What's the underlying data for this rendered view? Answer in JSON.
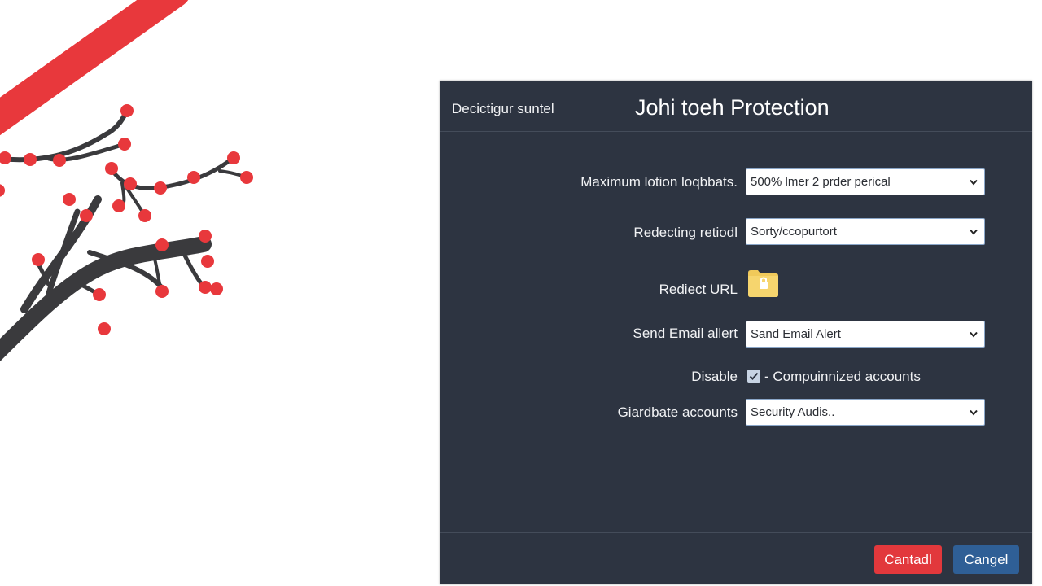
{
  "colors": {
    "dialog_bg": "#2d3441",
    "accent_red": "#e2383c",
    "accent_blue": "#2f5f96",
    "blossom": "#e8383c",
    "branch": "#3a3a3d"
  },
  "dialog": {
    "header_left": "Decictigur suntel",
    "title": "Johi toeh Protection",
    "rows": [
      {
        "label": "Maximum lotion loqbbats.",
        "control": "select",
        "value": "500% lmer 2 prder perical"
      },
      {
        "label": "Redecting retiodl",
        "control": "select",
        "value": "Sorty/ccopurtort"
      },
      {
        "label": "Rediect URL",
        "control": "folder",
        "icon": "folder-lock-icon"
      },
      {
        "label": "Send Email allert",
        "control": "select",
        "value": "Sand Email Alert"
      },
      {
        "label": "Disable",
        "control": "checkbox",
        "checked": true,
        "text": "- Compuinnized accounts"
      },
      {
        "label": "Giardbate accounts",
        "control": "select",
        "value": "Security Audis.."
      }
    ],
    "footer": {
      "primary_label": "Cantadl",
      "secondary_label": "Cangel"
    }
  }
}
